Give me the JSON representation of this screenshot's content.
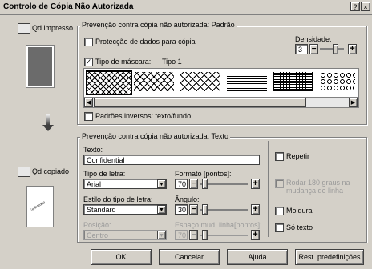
{
  "window": {
    "title": "Controlo de Cópia Não Autorizada"
  },
  "left": {
    "printed_label": "Qd impresso",
    "copied_label": "Qd copiado",
    "copied_preview_text": "Confidential"
  },
  "pattern_group": {
    "title": "Prevenção contra cópia não autorizada: Padrão",
    "protection_label": "Protecção de dados para cópia",
    "density_label": "Densidade:",
    "density_value": "3",
    "mask_type_label": "Tipo de máscara:",
    "mask_type_value": "Tipo 1",
    "inverse_label": "Padrões inversos: texto/fundo"
  },
  "text_group": {
    "title": "Prevenção contra cópia não autorizada: Texto",
    "text_label": "Texto:",
    "text_value": "Confidential",
    "font_label": "Tipo de letra:",
    "font_value": "Arial",
    "format_label": "Formato [pontos]:",
    "format_value": "70",
    "style_label": "Estilo do tipo de letra:",
    "style_value": "Standard",
    "angle_label": "Ângulo:",
    "angle_value": "30",
    "position_label": "Posição:",
    "position_value": "Centro",
    "spacing_label": "Espaço mud. linha[pontos]:",
    "spacing_value": "70",
    "repeat_label": "Repetir",
    "rotate_label": "Rodar 180 graus na mudança de linha",
    "frame_label": "Moldura",
    "text_only_label": "Só texto"
  },
  "buttons": {
    "ok": "OK",
    "cancel": "Cancelar",
    "help": "Ajuda",
    "reset": "Rest. predefinições"
  }
}
